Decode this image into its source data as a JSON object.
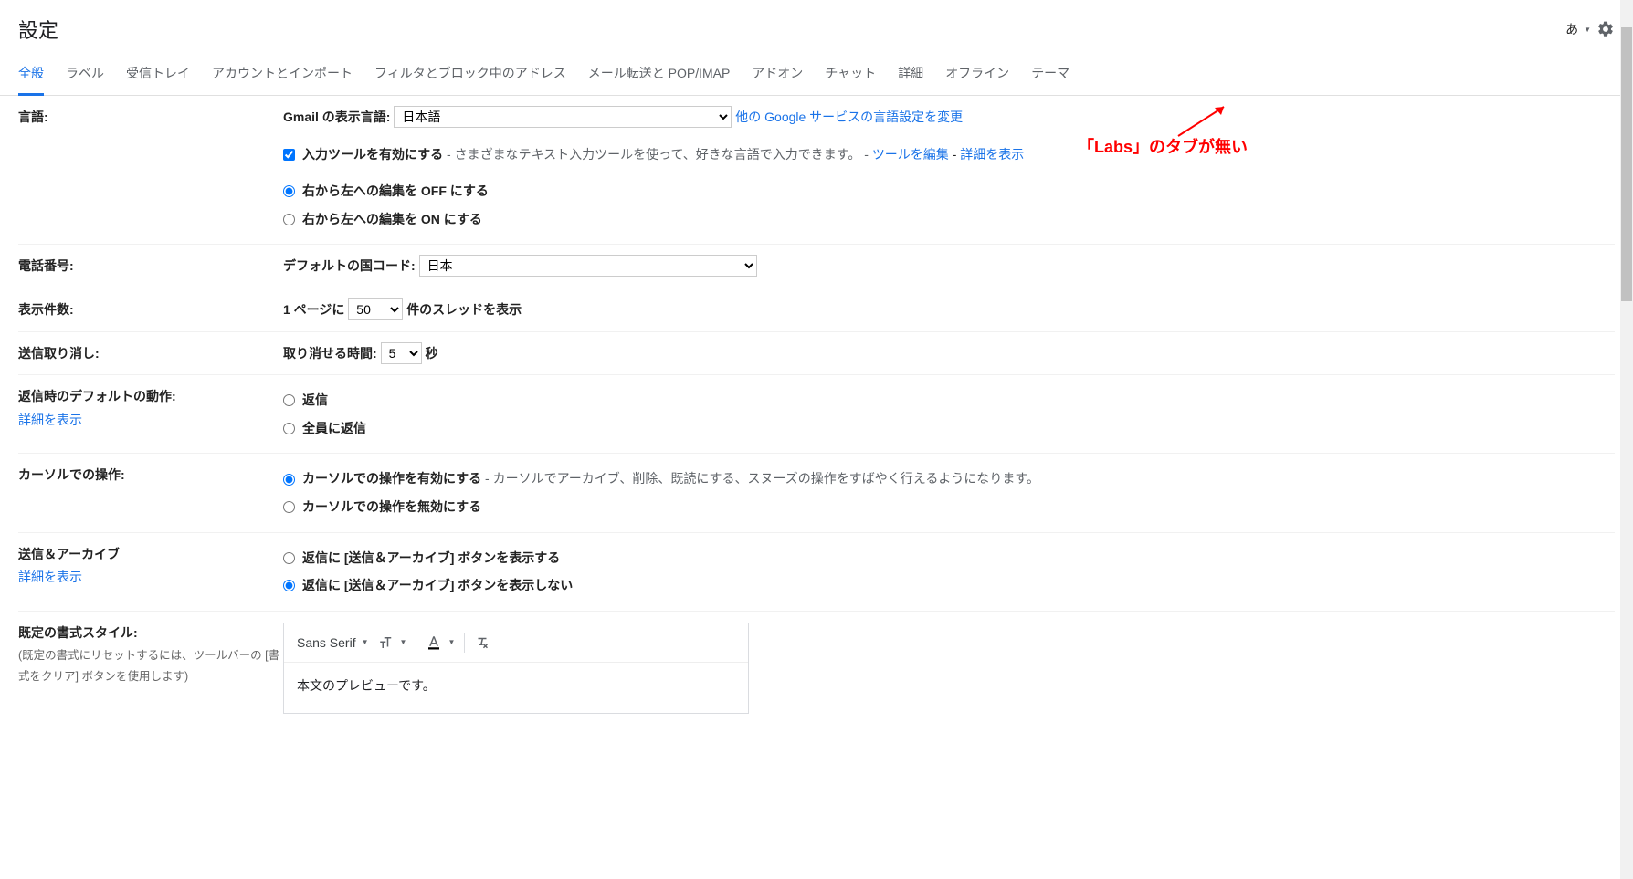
{
  "header": {
    "title": "設定",
    "lang_indicator": "あ"
  },
  "tabs": [
    {
      "label": "全般",
      "active": true
    },
    {
      "label": "ラベル"
    },
    {
      "label": "受信トレイ"
    },
    {
      "label": "アカウントとインポート"
    },
    {
      "label": "フィルタとブロック中のアドレス"
    },
    {
      "label": "メール転送と POP/IMAP"
    },
    {
      "label": "アドオン"
    },
    {
      "label": "チャット"
    },
    {
      "label": "詳細"
    },
    {
      "label": "オフライン"
    },
    {
      "label": "テーマ"
    }
  ],
  "annotation": {
    "text": "「Labs」のタブが無い"
  },
  "sections": {
    "language": {
      "label": "言語:",
      "display_lang_label": "Gmail の表示言語:",
      "display_lang_value": "日本語",
      "change_other_link": "他の Google サービスの言語設定を変更",
      "enable_input_tools_label": "入力ツールを有効にする",
      "enable_input_tools_help": " - さまざまなテキスト入力ツールを使って、好きな言語で入力できます。 - ",
      "edit_tools_link": "ツールを編集",
      "dash": " - ",
      "show_details_link": "詳細を表示",
      "rtl_off_label": "右から左への編集を OFF にする",
      "rtl_on_label": "右から左への編集を ON にする"
    },
    "phone": {
      "label": "電話番号:",
      "default_country_label": "デフォルトの国コード:",
      "default_country_value": "日本"
    },
    "page_size": {
      "label": "表示件数:",
      "prefix": "1 ページに",
      "value": "50",
      "suffix": "件のスレッドを表示"
    },
    "undo_send": {
      "label": "送信取り消し:",
      "prefix": "取り消せる時間:",
      "value": "5",
      "suffix": "秒"
    },
    "default_reply": {
      "label": "返信時のデフォルトの動作:",
      "show_details": "詳細を表示",
      "reply": "返信",
      "reply_all": "全員に返信"
    },
    "hover": {
      "label": "カーソルでの操作:",
      "enable_label": "カーソルでの操作を有効にする",
      "enable_help": " - カーソルでアーカイブ、削除、既読にする、スヌーズの操作をすばやく行えるようになります。",
      "disable_label": "カーソルでの操作を無効にする"
    },
    "send_archive": {
      "label": "送信＆アーカイブ",
      "show_details": "詳細を表示",
      "show_btn": "返信に [送信＆アーカイブ] ボタンを表示する",
      "hide_btn": "返信に [送信＆アーカイブ] ボタンを表示しない"
    },
    "default_style": {
      "label": "既定の書式スタイル:",
      "sub": "(既定の書式にリセットするには、ツールバーの [書式をクリア] ボタンを使用します)",
      "font_name": "Sans Serif",
      "preview": "本文のプレビューです。"
    }
  }
}
